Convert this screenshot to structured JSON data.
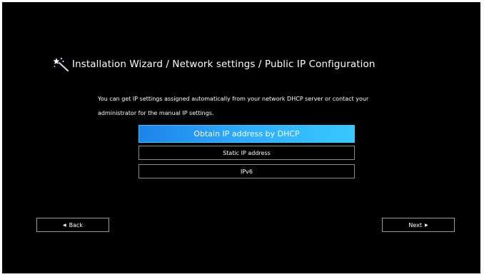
{
  "wizard": {
    "title": "Installation Wizard / Network settings / Public IP Configuration",
    "title_icon": "magic-wand-icon",
    "description_line1": "You can get IP settings assigned automatically from your network DHCP server or contact your",
    "description_line2": "administrator for the manual IP settings."
  },
  "options": [
    {
      "label": "Obtain IP address by DHCP",
      "selected": true
    },
    {
      "label": "Static IP address",
      "selected": false
    },
    {
      "label": "IPv6",
      "selected": false
    }
  ],
  "navigation": {
    "back_label": "Back",
    "back_icon": "triangle-left-icon",
    "next_label": "Next",
    "next_icon": "triangle-right-icon"
  },
  "colors": {
    "background": "#000000",
    "accent": "#2fb0ff",
    "text": "#ffffff"
  }
}
